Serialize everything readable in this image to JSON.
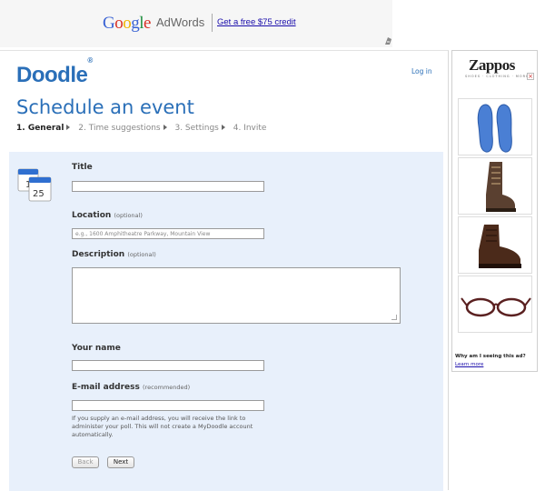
{
  "top_ad": {
    "google": "Google",
    "adwords": "AdWords",
    "credit_link": "Get a free $75 credit"
  },
  "header": {
    "logo": "Doodle",
    "logo_mark": "®",
    "login_link": "Log in",
    "title": "Schedule an event"
  },
  "steps": [
    {
      "label": "1. General",
      "active": true
    },
    {
      "label": "2. Time suggestions",
      "active": false
    },
    {
      "label": "3. Settings",
      "active": false
    },
    {
      "label": "4. Invite",
      "active": false
    }
  ],
  "calendar_icon": {
    "day1": "1",
    "day2": "25"
  },
  "form": {
    "title_label": "Title",
    "title_value": "",
    "location_label": "Location",
    "location_optional": "(optional)",
    "location_placeholder": "e.g., 1600 Amphitheatre Parkway, Mountain View",
    "description_label": "Description",
    "description_optional": "(optional)",
    "description_value": "",
    "name_label": "Your name",
    "name_value": "",
    "email_label": "E-mail address",
    "email_recommended": "(recommended)",
    "email_value": "",
    "email_help": "If you supply an e-mail address, you will receive the link to administer your poll. This will not create a MyDoodle account automatically.",
    "back_button": "Back",
    "next_button": "Next"
  },
  "side_ad": {
    "brand": "Zappos",
    "brand_sub": "SHOES · CLOTHING · MORE",
    "close": "×",
    "products": [
      "insoles",
      "lace-up boot",
      "leather boot",
      "eyeglasses"
    ],
    "why_text": "Why am I seeing this ad?",
    "learn_more": "Learn more"
  },
  "colors": {
    "accent": "#2a6fb8",
    "panel_bg": "#e8f0fb"
  }
}
